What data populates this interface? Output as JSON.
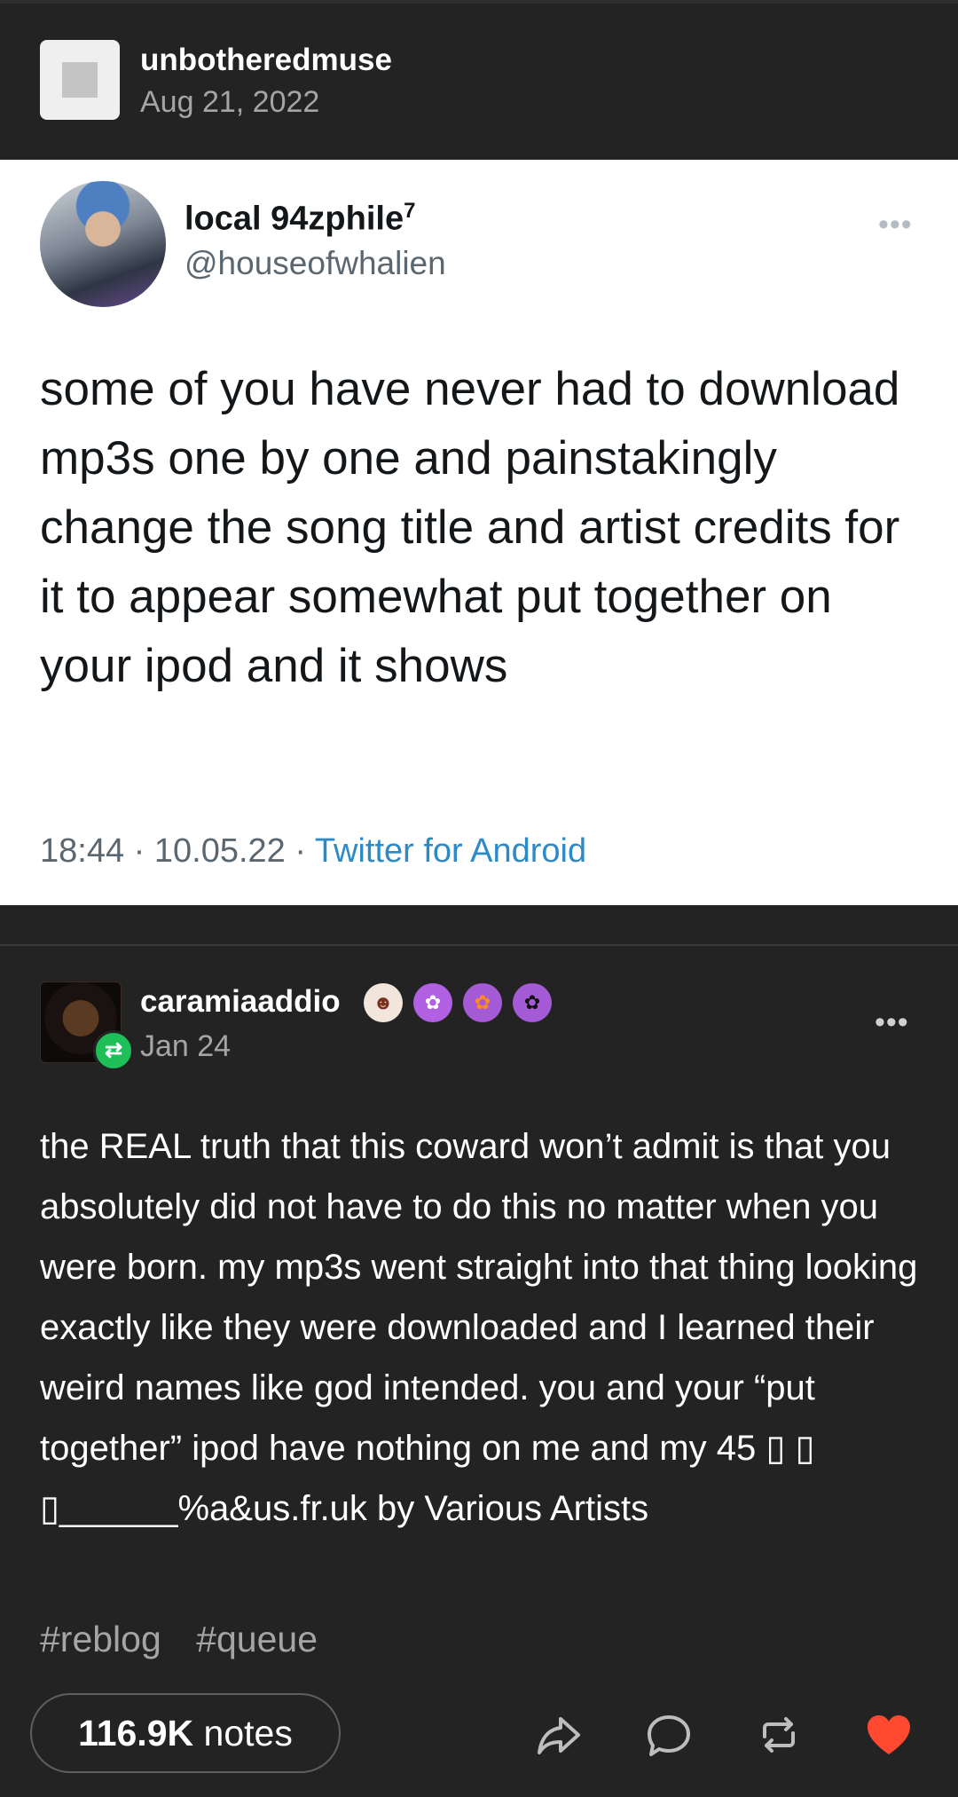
{
  "post": {
    "blog_name": "unbotheredmuse",
    "date": "Aug 21, 2022"
  },
  "tweet": {
    "display_name": "local 94zphile",
    "superscript": "7",
    "handle": "@houseofwhalien",
    "more_icon": "ellipsis-icon",
    "text": "some of you have never had to download mp3s one by one and painstakingly change the song title and artist credits for it to appear somewhat put together on your ipod and it shows",
    "time": "18:44",
    "date": "10.05.22",
    "separator": "·",
    "source": "Twitter for Android",
    "source_color": "#2c8ac9"
  },
  "reblog": {
    "blog_name": "caramiaaddio",
    "date": "Jan 24",
    "badge_icon": "reblog-icon",
    "badge_color": "#1ebe58",
    "badges": [
      {
        "icon": "mustache-man-icon",
        "color": "#f2e6dc"
      },
      {
        "icon": "pink-paw-icon",
        "color": "#b060e0"
      },
      {
        "icon": "orange-paw-icon",
        "color": "#a55ad6"
      },
      {
        "icon": "black-paw-icon",
        "color": "#a55ad6"
      }
    ],
    "text": "the REAL truth that this coward won’t admit is that you absolutely did not have to do this no matter when you were born. my mp3s went straight into that thing looking exactly like they were downloaded and I learned their weird names like god intended. you and your “put together” ipod have nothing on me and my 45 ▯ ▯ ▯______%a&us.fr.uk by Various Artists",
    "tags": [
      "#reblog",
      "#queue"
    ]
  },
  "footer": {
    "notes_count": "116.9K",
    "notes_label": "notes",
    "actions": [
      "share-icon",
      "reply-icon",
      "reblog-icon",
      "like-icon"
    ],
    "like_color": "#ff4930"
  }
}
